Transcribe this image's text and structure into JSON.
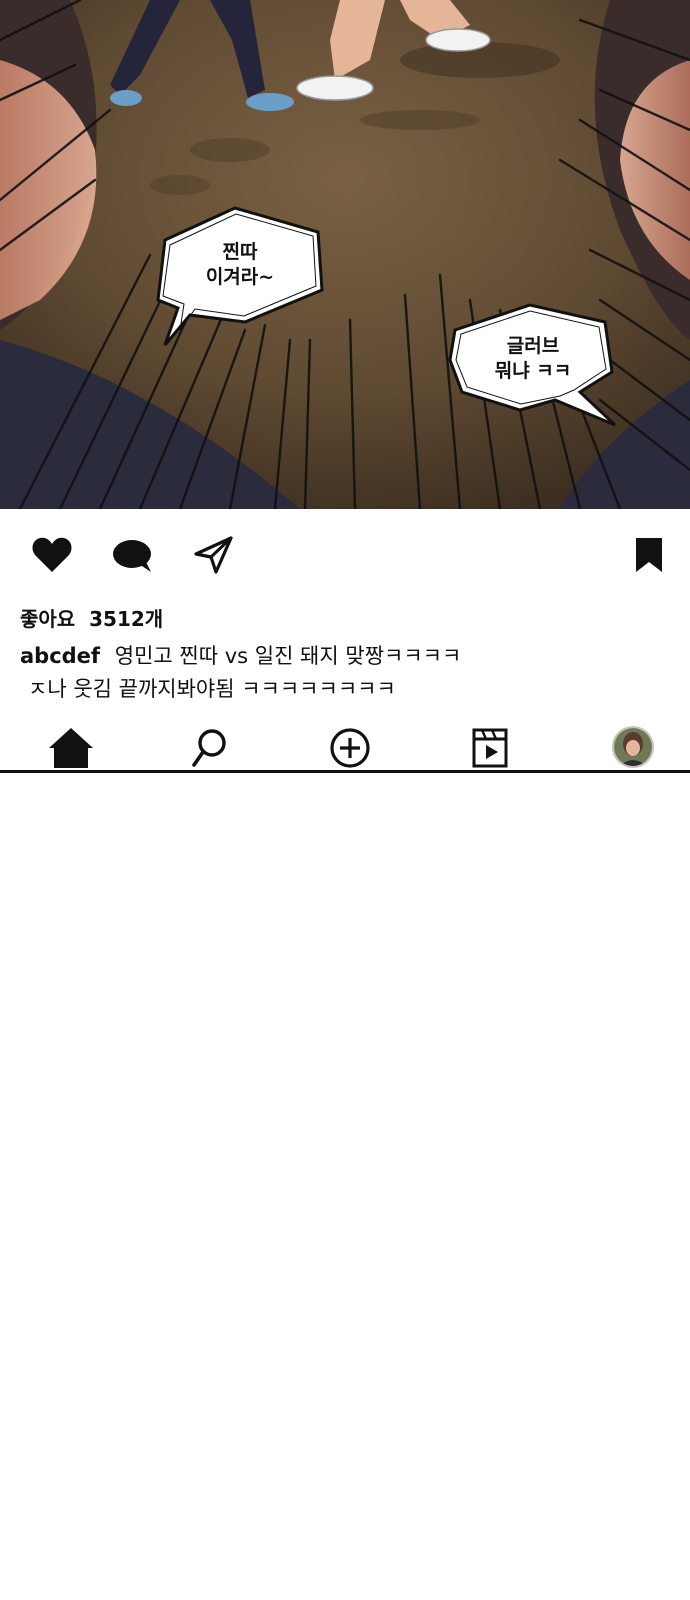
{
  "post": {
    "image_alt": "comic panel",
    "bubbles": [
      {
        "text": "찐따\n이겨라~"
      },
      {
        "text": "글러브\n뭐냐 ㅋㅋ"
      }
    ]
  },
  "actions": {
    "like_icon": "heart-icon",
    "comment_icon": "comment-bubble-icon",
    "share_icon": "paper-plane-icon",
    "save_icon": "bookmark-icon"
  },
  "likes": {
    "label": "좋아요  3512개"
  },
  "caption": {
    "username": "abcdef",
    "line1": "영민고 찐따 vs 일진 돼지 맞짱ㅋㅋㅋㅋ",
    "line2": "ㅈ나 웃김 끝까지봐야됨 ㅋㅋㅋㅋㅋㅋㅋㅋ"
  },
  "nav": {
    "items": [
      {
        "icon": "home-icon"
      },
      {
        "icon": "search-icon"
      },
      {
        "icon": "add-post-icon"
      },
      {
        "icon": "reels-icon"
      },
      {
        "icon": "profile-avatar"
      }
    ]
  },
  "colors": {
    "ground": "#6b5237",
    "ground_dark": "#3f3020",
    "skin": "#e2a88e",
    "jacket": "#2b2b38",
    "icon": "#111111"
  }
}
